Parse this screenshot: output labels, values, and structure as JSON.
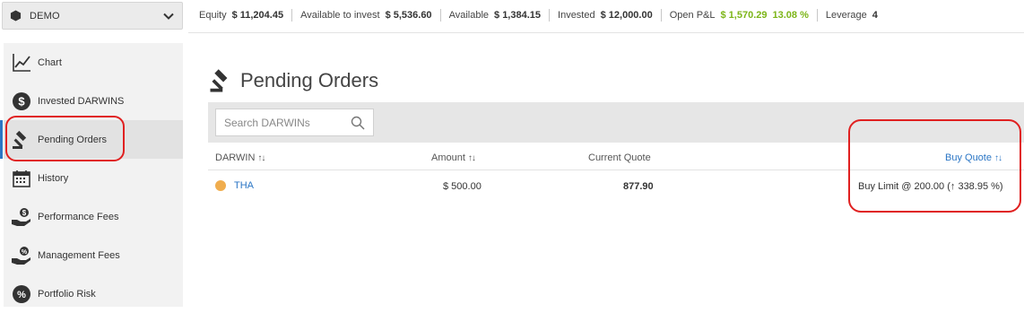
{
  "account": {
    "name": "DEMO"
  },
  "metrics": [
    {
      "label": "Equity",
      "value": "$ 11,204.45"
    },
    {
      "label": "Available to invest",
      "value": "$ 5,536.60"
    },
    {
      "label": "Available",
      "value": "$ 1,384.15"
    },
    {
      "label": "Invested",
      "value": "$ 12,000.00"
    },
    {
      "label": "Open P&L",
      "value": "$ 1,570.29",
      "percent": "13.08 %"
    },
    {
      "label": "Leverage",
      "value": "4"
    }
  ],
  "sidebar": {
    "items": [
      {
        "label": "Chart",
        "icon": "chart-icon"
      },
      {
        "label": "Invested DARWINS",
        "icon": "dollar-icon"
      },
      {
        "label": "Pending Orders",
        "icon": "gavel-icon",
        "active": true
      },
      {
        "label": "History",
        "icon": "calendar-icon"
      },
      {
        "label": "Performance Fees",
        "icon": "hand-coin-icon"
      },
      {
        "label": "Management Fees",
        "icon": "hand-percent-icon"
      },
      {
        "label": "Portfolio Risk",
        "icon": "percent-icon"
      }
    ]
  },
  "main": {
    "title": "Pending Orders",
    "search_placeholder": "Search DARWINs",
    "columns": {
      "darwin": "DARWIN",
      "amount": "Amount",
      "current_quote": "Current Quote",
      "buy_quote": "Buy Quote"
    },
    "sort_glyph": "↑↓",
    "rows": [
      {
        "darwin": "THA",
        "amount": "$ 500.00",
        "current_quote": "877.90",
        "buy_quote_prefix": "Buy Limit @ 200.00 (",
        "buy_quote_arrow": "↑",
        "buy_quote_suffix": " 338.95 %)"
      }
    ]
  },
  "colors": {
    "accent_blue": "#2b76c5",
    "pnl_green": "#7cb518",
    "annotation_red": "#e02020",
    "status_dot": "#f0ad4e"
  }
}
